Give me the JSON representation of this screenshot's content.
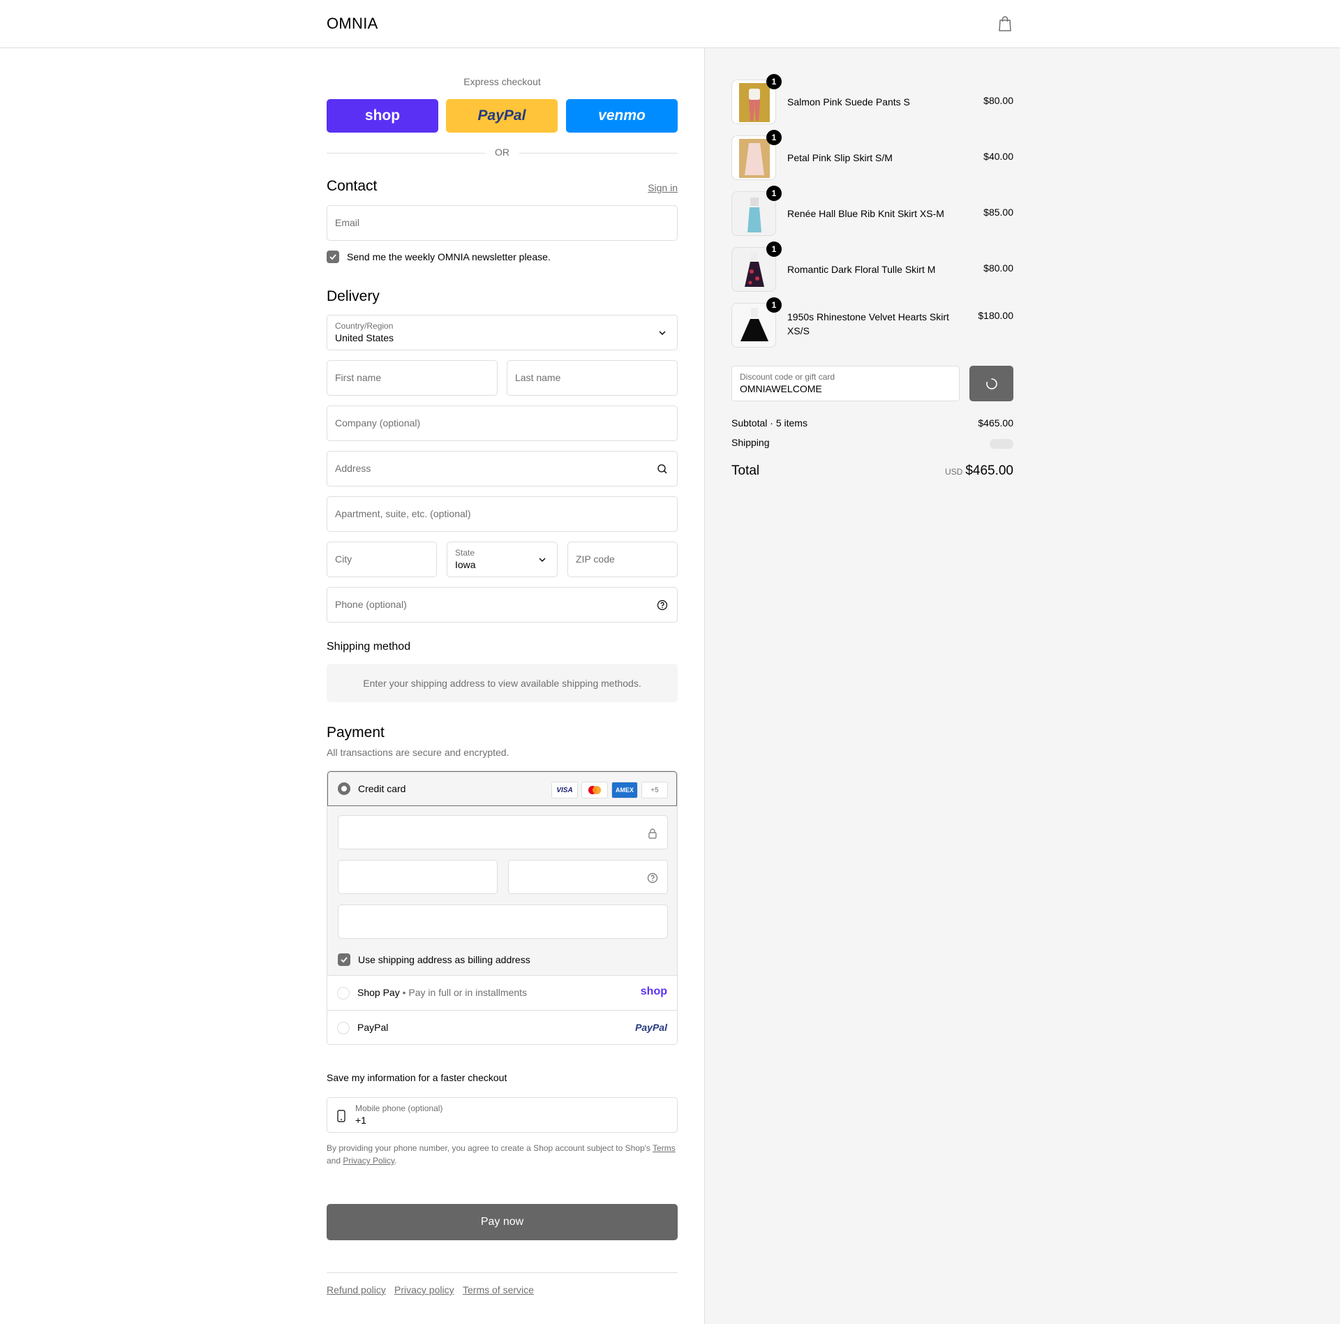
{
  "header": {
    "logo": "OMNIA",
    "cart_icon": "shopping-bag-icon"
  },
  "express": {
    "title": "Express checkout",
    "shop_label": "shop",
    "paypal_label": "PayPal",
    "venmo_label": "venmo",
    "or_label": "OR",
    "colors": {
      "shop": "#5a31f4",
      "paypal": "#ffc439",
      "venmo": "#008cff"
    }
  },
  "contact": {
    "heading": "Contact",
    "sign_in": "Sign in",
    "email_placeholder": "Email",
    "newsletter_label": "Send me the weekly OMNIA newsletter please.",
    "newsletter_checked": true
  },
  "delivery": {
    "heading": "Delivery",
    "country_label": "Country/Region",
    "country_value": "United States",
    "first_name_placeholder": "First name",
    "last_name_placeholder": "Last name",
    "company_placeholder": "Company (optional)",
    "address_placeholder": "Address",
    "apartment_placeholder": "Apartment, suite, etc. (optional)",
    "city_placeholder": "City",
    "state_label": "State",
    "state_value": "Iowa",
    "zip_placeholder": "ZIP code",
    "phone_placeholder": "Phone (optional)"
  },
  "shipping_method": {
    "heading": "Shipping method",
    "message": "Enter your shipping address to view available shipping methods."
  },
  "payment": {
    "heading": "Payment",
    "subtitle": "All transactions are secure and encrypted.",
    "credit_card_label": "Credit card",
    "card_brands": [
      "VISA",
      "Mastercard",
      "AMEX"
    ],
    "more_brands": "+5",
    "billing_same_label": "Use shipping address as billing address",
    "billing_same_checked": true,
    "shop_pay_label": "Shop Pay",
    "shop_pay_sub": "Pay in full or in installments",
    "shop_pay_logo": "shop",
    "paypal_label": "PayPal",
    "paypal_logo": "PayPal"
  },
  "save_info": {
    "title": "Save my information for a faster checkout",
    "mobile_label": "Mobile phone (optional)",
    "mobile_value": "+1",
    "legal_prefix": "By providing your phone number, you agree to create a Shop account subject to Shop's",
    "terms_link": "Terms",
    "legal_and": "and",
    "privacy_link": "Privacy Policy",
    "legal_suffix": "."
  },
  "pay_now_label": "Pay now",
  "footer_links": [
    "Refund policy",
    "Privacy policy",
    "Terms of service"
  ],
  "cart": {
    "items": [
      {
        "name": "Salmon Pink Suede Pants S",
        "price": "$80.00",
        "qty": "1"
      },
      {
        "name": "Petal Pink Slip Skirt S/M",
        "price": "$40.00",
        "qty": "1"
      },
      {
        "name": "Renée Hall Blue Rib Knit Skirt XS-M",
        "price": "$85.00",
        "qty": "1"
      },
      {
        "name": "Romantic Dark Floral Tulle Skirt M",
        "price": "$80.00",
        "qty": "1"
      },
      {
        "name": "1950s Rhinestone Velvet Hearts Skirt XS/S",
        "price": "$180.00",
        "qty": "1"
      }
    ],
    "discount_label": "Discount code or gift card",
    "discount_value": "OMNIAWELCOME",
    "subtotal_label": "Subtotal · 5 items",
    "subtotal_value": "$465.00",
    "shipping_label": "Shipping",
    "total_label": "Total",
    "currency": "USD",
    "total_value": "$465.00"
  }
}
